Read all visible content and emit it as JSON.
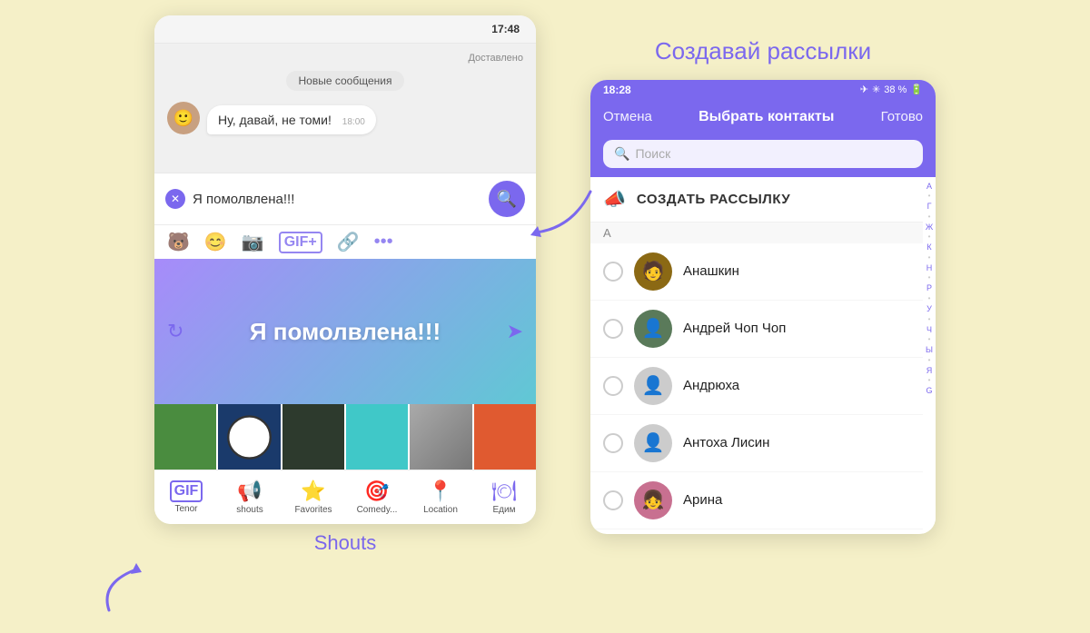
{
  "background": "#f5f0c8",
  "left": {
    "time": "17:48",
    "delivered": "Доставлено",
    "new_messages_label": "Новые сообщения",
    "incoming_msg": "Ну, давай, не томи!",
    "incoming_time": "18:00",
    "input_text": "Я помолвлена!!!",
    "gif_main_text": "Я помолвлена!!!",
    "shouts_label": "Shouts",
    "tabs": [
      {
        "icon": "🎭",
        "label": "Tenor"
      },
      {
        "icon": "📢",
        "label": "shouts"
      },
      {
        "icon": "⭐",
        "label": "Favorites"
      },
      {
        "icon": "😂",
        "label": "Comedy..."
      },
      {
        "icon": "📍",
        "label": "Location"
      },
      {
        "icon": "📦",
        "label": "Едим"
      }
    ]
  },
  "right": {
    "title": "Создавай рассылки",
    "status_time": "18:28",
    "status_icons": "✈ * 38% 🔋",
    "header_cancel": "Отмена",
    "header_title": "Выбрать контакты",
    "header_done": "Готово",
    "search_placeholder": "Поиск",
    "create_broadcast": "СОЗДАТЬ РАССЫЛКУ",
    "section_a": "А",
    "contacts": [
      {
        "name": "Анашкин",
        "has_photo": true,
        "letter": "А"
      },
      {
        "name": "Андрей Чоп Чоп",
        "has_photo": true,
        "letter": "А"
      },
      {
        "name": "Андрюха",
        "has_photo": false,
        "letter": "А"
      },
      {
        "name": "Антоха Лисин",
        "has_photo": false,
        "letter": "А"
      },
      {
        "name": "Арина",
        "has_photo": true,
        "letter": "А"
      }
    ],
    "alphabet": [
      "А",
      "●",
      "Г",
      "●",
      "Ж",
      "●",
      "К",
      "●",
      "Н",
      "●",
      "Р",
      "●",
      "У",
      "●",
      "Ч",
      "●",
      "Ы",
      "●",
      "Я",
      "●",
      "G"
    ]
  }
}
